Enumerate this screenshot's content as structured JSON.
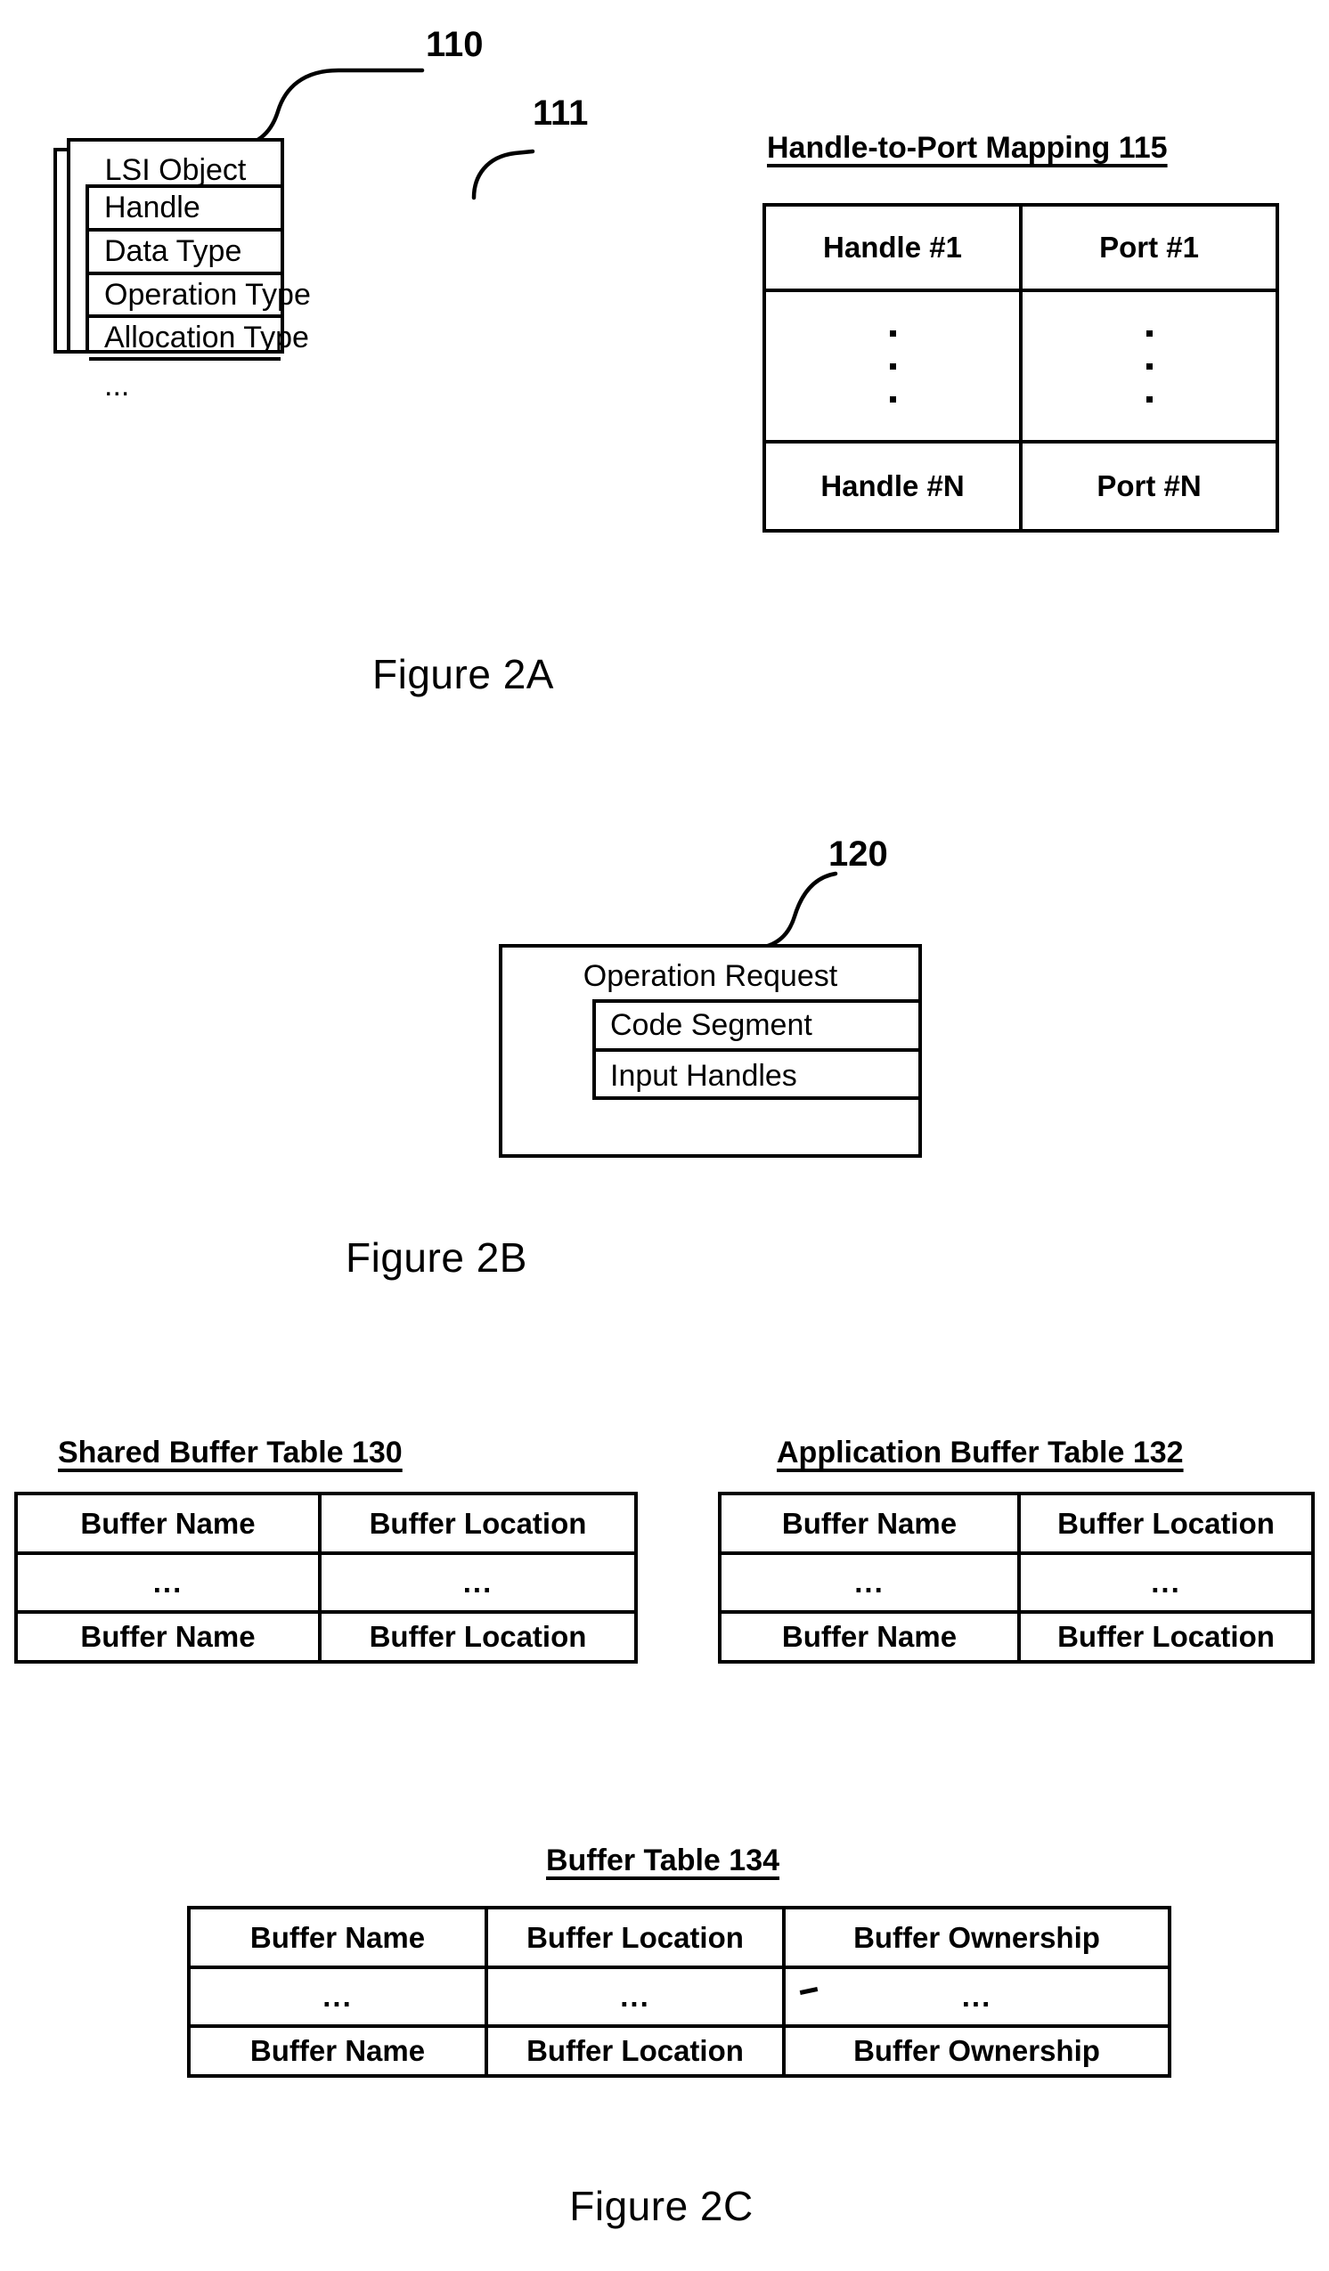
{
  "figure_2a": {
    "caption": "Figure 2A",
    "lsi_object": {
      "ref_numeral_object": "110",
      "ref_numeral_field": "111",
      "title": "LSI Object",
      "fields": [
        "Handle",
        "Data Type",
        "Operation Type",
        "Allocation Type",
        "..."
      ]
    },
    "handle_to_port_mapping": {
      "title": "Handle-to-Port Mapping 115",
      "rows": [
        [
          "Handle #1",
          "Port #1"
        ],
        [
          "vdots",
          "vdots"
        ],
        [
          "Handle #N",
          "Port #N"
        ]
      ]
    }
  },
  "figure_2b": {
    "caption": "Figure 2B",
    "operation_request": {
      "ref_numeral": "120",
      "title": "Operation Request",
      "fields": [
        "Code Segment",
        "Input Handles"
      ]
    }
  },
  "figure_2c": {
    "caption": "Figure 2C",
    "shared_buffer_table": {
      "title": "Shared Buffer Table 130",
      "rows": [
        [
          "Buffer Name",
          "Buffer Location"
        ],
        [
          "...",
          "..."
        ],
        [
          "Buffer Name",
          "Buffer Location"
        ]
      ]
    },
    "application_buffer_table": {
      "title": "Application Buffer Table 132",
      "rows": [
        [
          "Buffer Name",
          "Buffer Location"
        ],
        [
          "...",
          "..."
        ],
        [
          "Buffer Name",
          "Buffer Location"
        ]
      ]
    },
    "buffer_table": {
      "title": "Buffer Table 134",
      "rows": [
        [
          "Buffer Name",
          "Buffer Location",
          "Buffer Ownership"
        ],
        [
          "...",
          "...",
          "..."
        ],
        [
          "Buffer Name",
          "Buffer Location",
          "Buffer Ownership"
        ]
      ]
    }
  },
  "colors": {
    "ink": "#000000",
    "paper": "#ffffff"
  }
}
